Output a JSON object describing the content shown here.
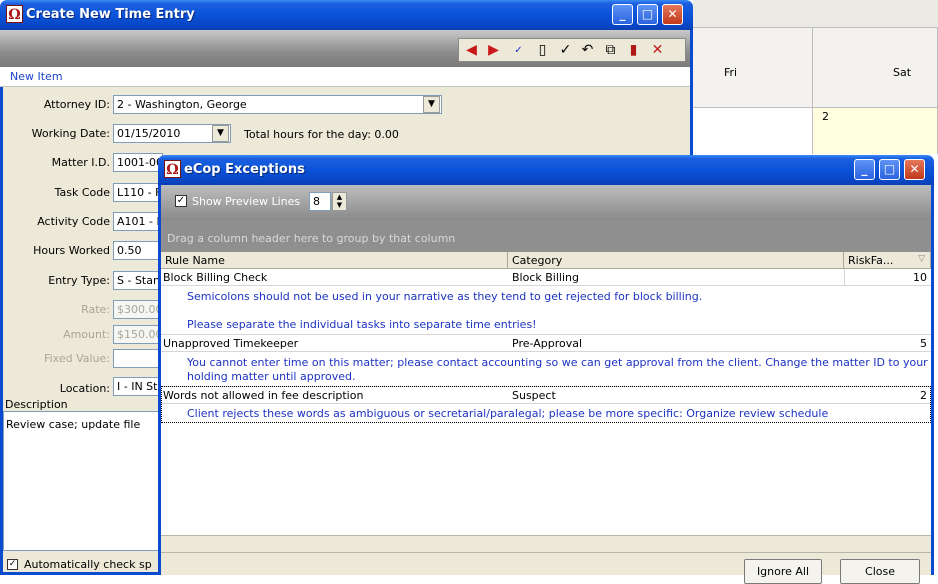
{
  "calendar": {
    "days": [
      "Fri",
      "Sat"
    ],
    "date_label": "2"
  },
  "main_window": {
    "title": "Create New Time Entry",
    "new_item_label": "New Item",
    "toolbar_icons": [
      "left-arrow-icon",
      "right-arrow-icon",
      "spellcheck-icon",
      "new-document-icon",
      "checkmark-icon",
      "undo-icon",
      "split-icon",
      "save-icon",
      "delete-icon"
    ],
    "fields": {
      "attorney_id": {
        "label": "Attorney ID:",
        "value": "2 - Washington, George"
      },
      "working_date": {
        "label": "Working Date:",
        "value": "01/15/2010"
      },
      "total_hours": "Total hours for the day: 0.00",
      "matter_id": {
        "label": "Matter I.D.",
        "value": "1001-00"
      },
      "task_code": {
        "label": "Task Code",
        "value": "L110 - F"
      },
      "activity_code": {
        "label": "Activity Code",
        "value": "A101 - F"
      },
      "hours_worked": {
        "label": "Hours Worked",
        "value": "0.50"
      },
      "entry_type": {
        "label": "Entry Type:",
        "value": "S - Stan"
      },
      "rate": {
        "label": "Rate:",
        "value": "$300.00"
      },
      "amount": {
        "label": "Amount:",
        "value": "$150.00"
      },
      "fixed_value": {
        "label": "Fixed Value:",
        "value": ""
      },
      "location": {
        "label": "Location:",
        "value": "I - IN Sta"
      }
    },
    "description_label": "Description",
    "description_text": "Review case; update file",
    "auto_check_label": "Automatically check sp"
  },
  "dialog": {
    "title": "eCop Exceptions",
    "show_preview_label": "Show Preview Lines",
    "preview_lines": "8",
    "group_hint": "Drag a column header here to group by that column",
    "columns": [
      "Rule Name",
      "Category",
      "RiskFa..."
    ],
    "rows": [
      {
        "rule": "Block Billing Check",
        "category": "Block Billing",
        "risk": "10",
        "preview": [
          "Semicolons should not be used in your narrative as they tend to get rejected for block billing.",
          "",
          "Please separate the individual tasks into separate time entries!"
        ]
      },
      {
        "rule": "Unapproved Timekeeper",
        "category": "Pre-Approval",
        "risk": "5",
        "preview": [
          "You cannot enter time on this matter; please contact accounting so we can get approval from the client.  Change the matter ID to your",
          "holding matter until approved."
        ]
      },
      {
        "rule": "Words not allowed in fee description",
        "category": "Suspect",
        "risk": "2",
        "preview": [
          "Client rejects these words as ambiguous or secretarial/paralegal; please be more specific: Organize  review  schedule"
        ]
      }
    ],
    "ignore_all_label": "Ignore All",
    "close_label": "Close"
  }
}
